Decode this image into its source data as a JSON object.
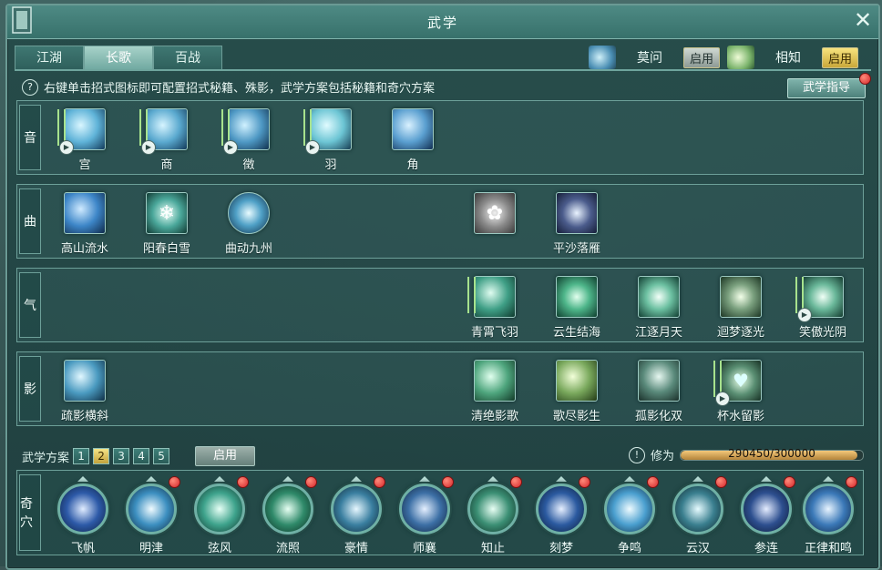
{
  "window": {
    "title": "武学"
  },
  "tabs": [
    {
      "label": "江湖"
    },
    {
      "label": "长歌"
    },
    {
      "label": "百战"
    }
  ],
  "flows": [
    {
      "name": "莫问",
      "enable_label": "启用",
      "state": "off"
    },
    {
      "name": "相知",
      "enable_label": "启用",
      "state": "on"
    }
  ],
  "hint": {
    "icon": "question-icon",
    "text": "右键单击招式图标即可配置招式秘籍、殊影，武学方案包括秘籍和奇穴方案"
  },
  "guide_button": {
    "label": "武学指导"
  },
  "rows": [
    {
      "label": "音",
      "skills": [
        {
          "name": "宫",
          "icon": "palm-light-icon",
          "color": "#5fb3d8"
        },
        {
          "name": "商",
          "icon": "swirl-hand-icon",
          "color": "#5aa9cf"
        },
        {
          "name": "徵",
          "icon": "wave-hand-icon",
          "color": "#4e98c4"
        },
        {
          "name": "羽",
          "icon": "feather-slash-icon",
          "color": "#6cc5d4"
        },
        {
          "name": "角",
          "icon": "spiral-hand-icon",
          "color": "#5a9fd0"
        }
      ]
    },
    {
      "label": "曲",
      "skills": [
        {
          "name": "高山流水",
          "icon": "water-flow-icon",
          "color": "#3d86c8"
        },
        {
          "name": "阳春白雪",
          "icon": "snowflake-icon",
          "color": "#4aa79a"
        },
        {
          "name": "曲动九州",
          "icon": "orb-icon",
          "color": "#4fa0c6"
        },
        {
          "name": "",
          "icon": "flower-icon",
          "color": "#8a8a8a"
        },
        {
          "name": "平沙落雁",
          "icon": "figure-light-icon",
          "color": "#4b5c8c"
        }
      ]
    },
    {
      "label": "气",
      "skills": [
        {
          "name": "青霄飞羽",
          "icon": "feather-icon",
          "color": "#3f9f86"
        },
        {
          "name": "云生结海",
          "icon": "cloud-icon",
          "color": "#4eb68a"
        },
        {
          "name": "江逐月天",
          "icon": "moon-burst-icon",
          "color": "#6cc0a1"
        },
        {
          "name": "迴梦逐光",
          "icon": "dream-light-icon",
          "color": "#7aa07e"
        },
        {
          "name": "笑傲光阴",
          "icon": "time-swirl-icon",
          "color": "#6ab89a"
        }
      ]
    },
    {
      "label": "影",
      "skills": [
        {
          "name": "疏影横斜",
          "icon": "shadow-runner-icon",
          "color": "#4a9ac0"
        },
        {
          "name": "清绝影歌",
          "icon": "shadow-dash-icon",
          "color": "#4ea57d"
        },
        {
          "name": "歌尽影生",
          "icon": "shadow-sword-icon",
          "color": "#79a85c"
        },
        {
          "name": "孤影化双",
          "icon": "twin-shadow-icon",
          "color": "#5a8a7b"
        },
        {
          "name": "杯水留影",
          "icon": "heart-cup-icon",
          "color": "#5a8f73"
        }
      ]
    }
  ],
  "plan": {
    "label": "武学方案",
    "numbers": [
      "1",
      "2",
      "3",
      "4",
      "5"
    ],
    "selected": "2",
    "enable_label": "启用"
  },
  "cultivation": {
    "label": "修为",
    "value_text": "290450/300000",
    "current": 290450,
    "max": 300000
  },
  "qixue": {
    "label": "奇穴",
    "points": [
      {
        "name": "飞帆",
        "icon": "taiji-icon",
        "color": "#2d5aa8"
      },
      {
        "name": "明津",
        "icon": "bright-orb-icon",
        "color": "#3c8fc0"
      },
      {
        "name": "弦风",
        "icon": "wind-slash-icon",
        "color": "#3ea38c"
      },
      {
        "name": "流照",
        "icon": "light-stream-icon",
        "color": "#2f8a6a"
      },
      {
        "name": "豪情",
        "icon": "vortex-icon",
        "color": "#3a7fa0"
      },
      {
        "name": "师襄",
        "icon": "harp-icon",
        "color": "#3c6fa5"
      },
      {
        "name": "知止",
        "icon": "scroll-icon",
        "color": "#3b8f74"
      },
      {
        "name": "刻梦",
        "icon": "star-burst-icon",
        "color": "#2b5aa0"
      },
      {
        "name": "争鸣",
        "icon": "wave-icon",
        "color": "#4a9fcf"
      },
      {
        "name": "云汉",
        "icon": "dancer-icon",
        "color": "#3a7f8f"
      },
      {
        "name": "参连",
        "icon": "hand-icon",
        "color": "#2d4f8f"
      },
      {
        "name": "正律和鸣",
        "icon": "resonance-icon",
        "color": "#3b79b8"
      }
    ]
  }
}
